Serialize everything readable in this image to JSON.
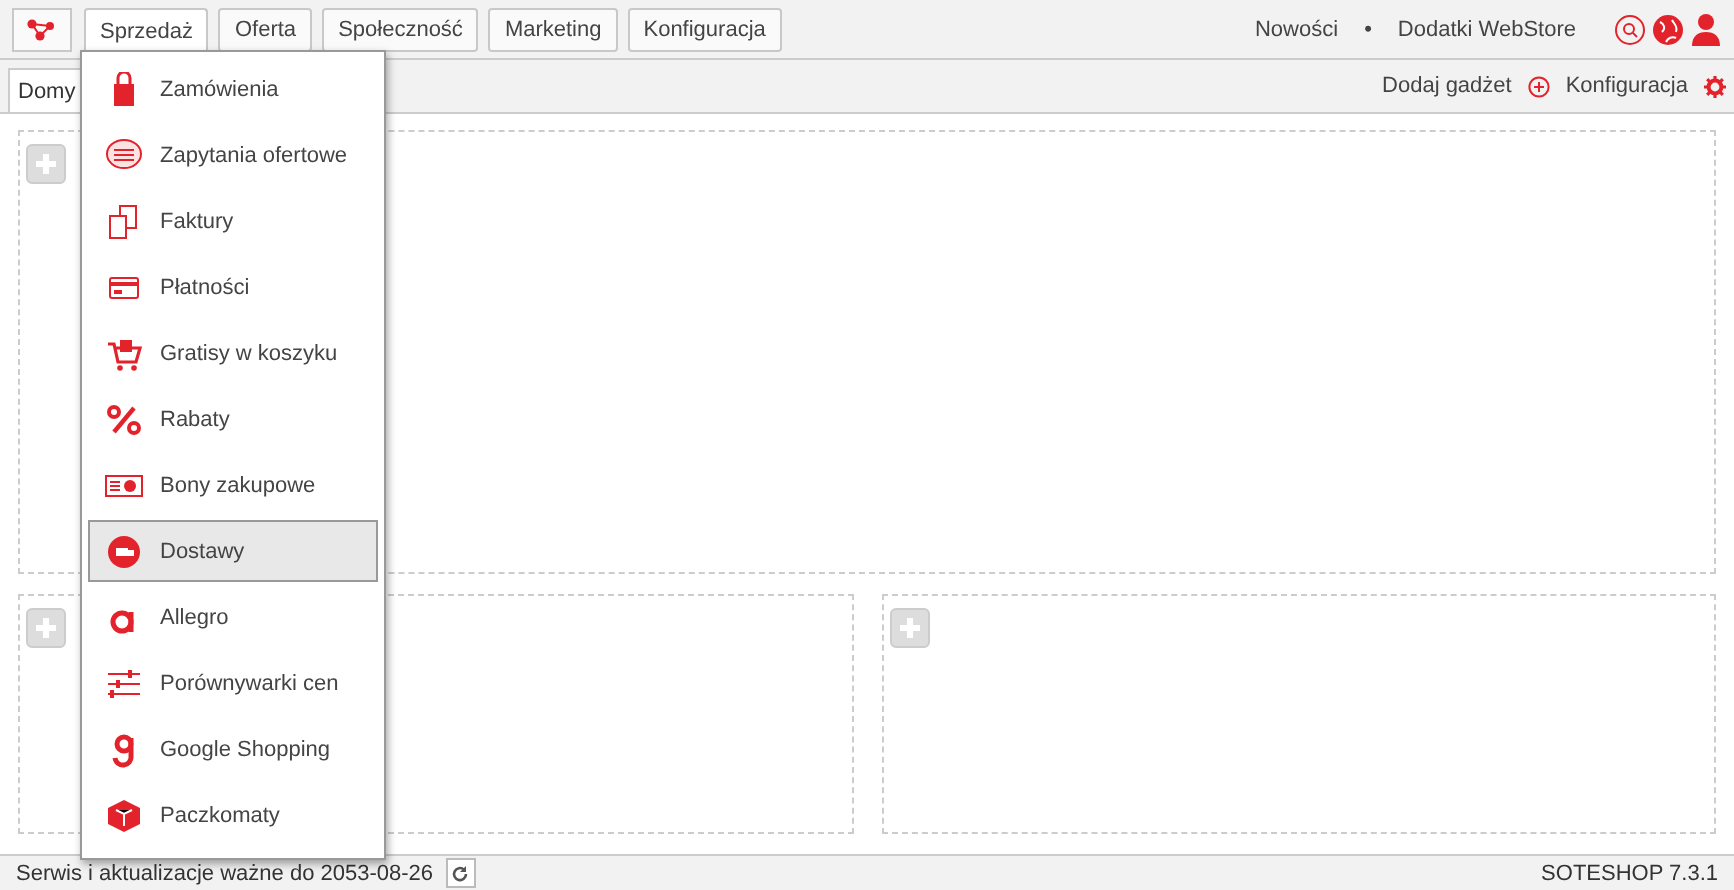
{
  "nav": [
    {
      "label": "Sprzedaż",
      "selected": true
    },
    {
      "label": "Oferta",
      "selected": false
    },
    {
      "label": "Społeczność",
      "selected": false
    },
    {
      "label": "Marketing",
      "selected": false
    },
    {
      "label": "Konfiguracja",
      "selected": false
    }
  ],
  "top_links": [
    "Nowości",
    "•",
    "Dodatki WebStore"
  ],
  "tabs": [
    {
      "label": "Domy",
      "selected": true
    }
  ],
  "toolbar": {
    "add_gadget": "Dodaj gadżet",
    "config": "Konfiguracja"
  },
  "menu": [
    {
      "label": "Zamówienia",
      "selected": false
    },
    {
      "label": "Zapytania ofertowe",
      "selected": false
    },
    {
      "label": "Faktury",
      "selected": false
    },
    {
      "label": "Płatności",
      "selected": false
    },
    {
      "label": "Gratisy w koszyku",
      "selected": false
    },
    {
      "label": "Rabaty",
      "selected": false
    },
    {
      "label": "Bony zakupowe",
      "selected": false
    },
    {
      "label": "Dostawy",
      "selected": true
    },
    {
      "label": "Allegro",
      "selected": false
    },
    {
      "label": "Porównywarki cen",
      "selected": false
    },
    {
      "label": "Google Shopping",
      "selected": false
    },
    {
      "label": "Paczkomaty",
      "selected": false
    }
  ],
  "status_bar": {
    "text": "Serwis i aktualizacje ważne do 2053-08-26",
    "version": "SOTESHOP 7.3.1"
  }
}
